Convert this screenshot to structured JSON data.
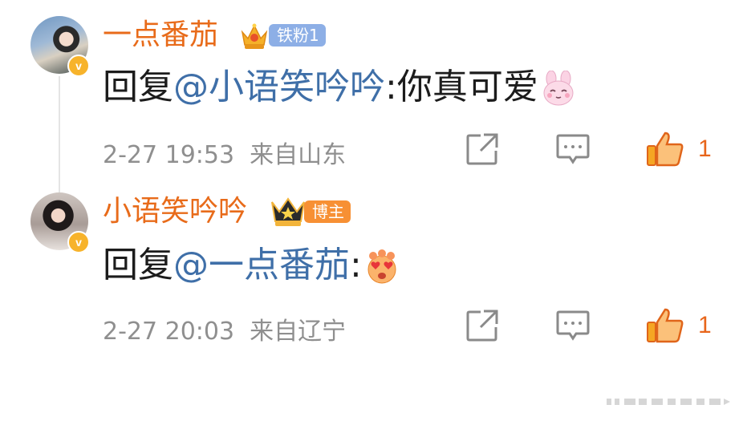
{
  "comments": [
    {
      "username": "一点番茄",
      "badge": "铁粉1",
      "reply_prefix": "回复",
      "mention": "@小语笑吟吟",
      "separator": ":",
      "text": "你真可爱",
      "emoji": "bunny-emoji",
      "timestamp": "2-27 19:53",
      "location": "来自山东",
      "likes": "1"
    },
    {
      "username": "小语笑吟吟",
      "badge": "博主",
      "reply_prefix": "回复",
      "mention": "@一点番茄",
      "separator": ":",
      "text": "",
      "emoji": "heart-eyes-emoji",
      "timestamp": "2-27 20:03",
      "location": "来自辽宁",
      "likes": "1"
    }
  ],
  "colors": {
    "username": "#e86b1a",
    "mention": "#3f6fa8",
    "meta": "#8f8f8f",
    "like": "#e8651a",
    "fan_badge": "#8dafe6",
    "blogger_badge": "#f79034"
  }
}
